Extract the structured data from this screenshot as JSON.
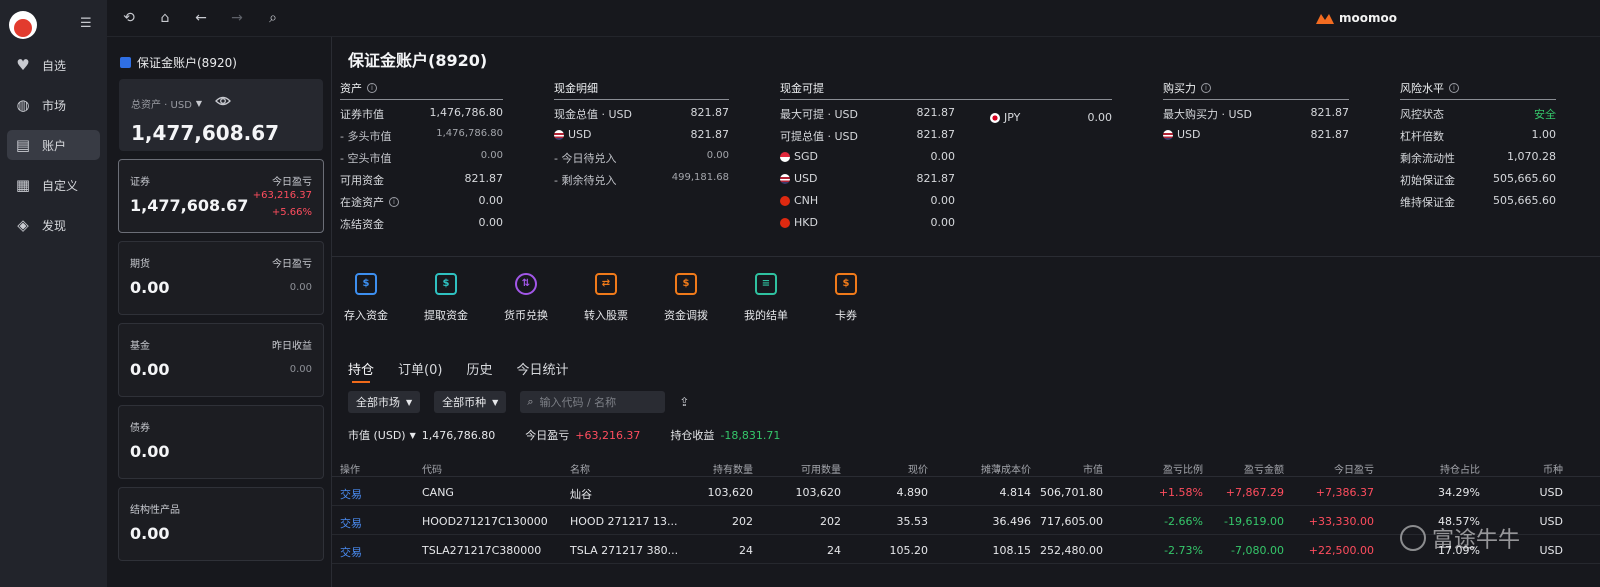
{
  "nav": {
    "items": [
      {
        "label": "自选",
        "icon": "heart-icon"
      },
      {
        "label": "市场",
        "icon": "planet-icon"
      },
      {
        "label": "账户",
        "icon": "wallet-icon",
        "active": true
      },
      {
        "label": "自定义",
        "icon": "layout-icon"
      },
      {
        "label": "发现",
        "icon": "compass-icon"
      }
    ]
  },
  "topbar": {
    "icons": [
      "history-icon",
      "home-icon",
      "back-arrow-icon",
      "forward-arrow-icon",
      "search-icon"
    ],
    "brand": "moomoo"
  },
  "left": {
    "account_title": "保证金账户(8920)",
    "total_label": "总资产 · USD",
    "total_value": "1,477,608.67",
    "cards": [
      {
        "name": "证券",
        "pnl_label": "今日盈亏",
        "value": "1,477,608.67",
        "pnl": "+63,216.37",
        "pnl_pct": "+5.66%"
      },
      {
        "name": "期货",
        "pnl_label": "今日盈亏",
        "value": "0.00",
        "pnl": "0.00"
      },
      {
        "name": "基金",
        "pnl_label": "昨日收益",
        "value": "0.00",
        "pnl": "0.00"
      },
      {
        "name": "债券",
        "value": "0.00"
      },
      {
        "name": "结构性产品",
        "value": "0.00"
      }
    ]
  },
  "main": {
    "title": "保证金账户(8920)",
    "assets": {
      "header": "资产",
      "rows": [
        {
          "label": "证券市值",
          "value": "1,476,786.80"
        },
        {
          "label": "- 多头市值",
          "value": "1,476,786.80"
        },
        {
          "label": "- 空头市值",
          "value": "0.00"
        },
        {
          "label": "可用资金",
          "value": "821.87"
        },
        {
          "label": "在途资产",
          "value": "0.00"
        },
        {
          "label": "冻结资金",
          "value": "0.00"
        }
      ]
    },
    "cash_detail": {
      "header": "现金明细",
      "rows": [
        {
          "label": "现金总值 · USD",
          "value": "821.87"
        },
        {
          "label": "USD",
          "value": "821.87"
        },
        {
          "label": "- 今日待兑入",
          "value": "0.00"
        },
        {
          "label": "- 剩余待兑入",
          "value": "499,181.68"
        }
      ]
    },
    "cash_withdraw": {
      "header": "现金可提",
      "rows": [
        {
          "label": "最大可提 · USD",
          "value": "821.87"
        },
        {
          "label": "可提总值 · USD",
          "value": "821.87"
        },
        {
          "label": "SGD",
          "value": "0.00"
        },
        {
          "label": "USD",
          "value": "821.87"
        },
        {
          "label": "CNH",
          "value": "0.00"
        },
        {
          "label": "HKD",
          "value": "0.00"
        }
      ],
      "extra": {
        "label": "JPY",
        "value": "0.00"
      }
    },
    "buying_power": {
      "header": "购买力",
      "rows": [
        {
          "label": "最大购买力 · USD",
          "value": "821.87"
        },
        {
          "label": "USD",
          "value": "821.87"
        }
      ]
    },
    "risk": {
      "header": "风险水平",
      "rows": [
        {
          "label": "风控状态",
          "value": "安全"
        },
        {
          "label": "杠杆倍数",
          "value": "1.00"
        },
        {
          "label": "剩余流动性",
          "value": "1,070.28"
        },
        {
          "label": "初始保证金",
          "value": "505,665.60"
        },
        {
          "label": "维持保证金",
          "value": "505,665.60"
        }
      ]
    },
    "actions": [
      {
        "label": "存入资金",
        "icon": "deposit-icon",
        "color": "#3d8ff0"
      },
      {
        "label": "提取资金",
        "icon": "withdraw-icon",
        "color": "#2fc1c1"
      },
      {
        "label": "货币兑换",
        "icon": "exchange-icon",
        "color": "#a257e8"
      },
      {
        "label": "转入股票",
        "icon": "transfer-stock-icon",
        "color": "#f07a1a"
      },
      {
        "label": "资金调拨",
        "icon": "fund-transfer-icon",
        "color": "#f07a1a"
      },
      {
        "label": "我的结单",
        "icon": "statement-icon",
        "color": "#2fc1a0"
      },
      {
        "label": "卡券",
        "icon": "coupon-icon",
        "color": "#f07a1a"
      }
    ],
    "tabs": [
      "持仓",
      "订单(0)",
      "历史",
      "今日统计"
    ],
    "filters": {
      "market": "全部市场",
      "currency": "全部币种",
      "search_placeholder": "输入代码 / 名称"
    },
    "summary": {
      "mv_label": "市值 (USD)",
      "mv_value": "1,476,786.80",
      "today_label": "今日盈亏",
      "today_value": "+63,216.37",
      "hold_label": "持仓收益",
      "hold_value": "-18,831.71"
    },
    "table": {
      "headers": [
        "操作",
        "代码",
        "名称",
        "持有数量",
        "可用数量",
        "现价",
        "摊薄成本价",
        "市值",
        "盈亏比例",
        "盈亏金额",
        "今日盈亏",
        "持仓占比",
        "币种"
      ],
      "rows": [
        [
          "交易",
          "CANG",
          "灿谷",
          "103,620",
          "103,620",
          "4.890",
          "4.814",
          "506,701.80",
          "+1.58%",
          "+7,867.29",
          "+7,386.37",
          "34.29%",
          "USD"
        ],
        [
          "交易",
          "HOOD271217C130000",
          "HOOD 271217 13...",
          "202",
          "202",
          "35.53",
          "36.496",
          "717,605.00",
          "-2.66%",
          "-19,619.00",
          "+33,330.00",
          "48.57%",
          "USD"
        ],
        [
          "交易",
          "TSLA271217C380000",
          "TSLA 271217 380...",
          "24",
          "24",
          "105.20",
          "108.15",
          "252,480.00",
          "-2.73%",
          "-7,080.00",
          "+22,500.00",
          "17.09%",
          "USD"
        ]
      ]
    },
    "watermark": "富途牛牛"
  }
}
